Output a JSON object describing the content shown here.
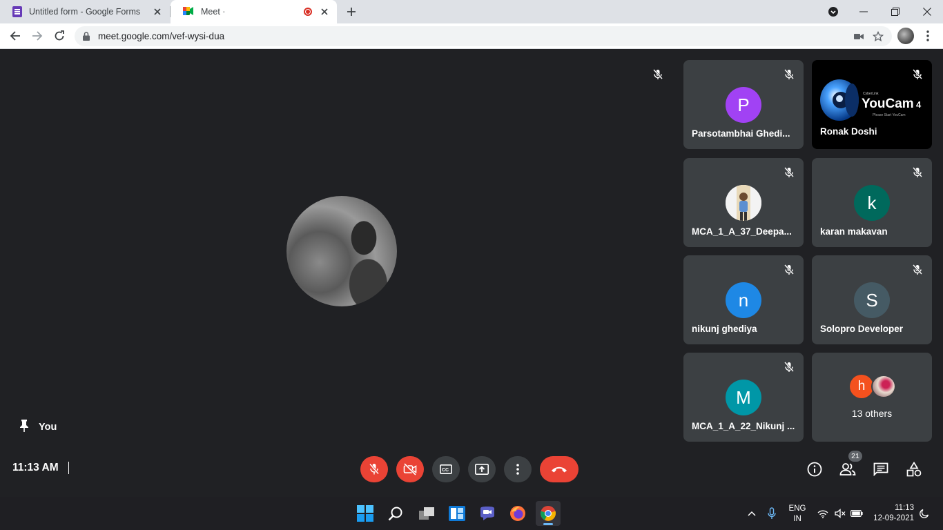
{
  "browser": {
    "tabs": [
      {
        "title": "Untitled form - Google Forms",
        "icon": "google-forms-icon"
      },
      {
        "title": "Meet ·",
        "icon": "google-meet-icon",
        "recording": true,
        "active": true
      }
    ],
    "url": "meet.google.com/vef-wysi-dua"
  },
  "meet": {
    "self_label": "You",
    "participants": [
      {
        "name": "Parsotambhai Ghedi...",
        "initial": "P",
        "color": "#a142f4"
      },
      {
        "name": "Ronak Doshi",
        "video": "YouCam 4",
        "logo_text": "YouCam",
        "logo_version": "4",
        "logo_small": "CyberLink",
        "logo_hint": "Please Start YouCam"
      },
      {
        "name": "MCA_1_A_37_Deepa...",
        "avatar": "photo"
      },
      {
        "name": "karan makavan",
        "initial": "k",
        "color": "#00695c"
      },
      {
        "name": "nikunj ghediya",
        "initial": "n",
        "color": "#1e88e5"
      },
      {
        "name": "Solopro Developer",
        "initial": "S",
        "color": "#455a64"
      },
      {
        "name": "MCA_1_A_22_Nikunj ...",
        "initial": "M",
        "color": "#0097a7"
      }
    ],
    "others": {
      "label": "13 others",
      "initial": "h",
      "initial_color": "#f4511e"
    },
    "clock": "11:13 AM",
    "participant_count": "21",
    "controls": {
      "mic": "mic-off",
      "camera": "camera-off",
      "captions": "captions",
      "present": "present-now",
      "more": "more-options",
      "leave": "leave-call"
    }
  },
  "taskbar": {
    "lang_line1": "ENG",
    "lang_line2": "IN",
    "time": "11:13",
    "date": "12-09-2021"
  },
  "colors": {
    "meet_bg": "#202124",
    "tile_bg": "#3c4043",
    "danger": "#ea4335"
  }
}
